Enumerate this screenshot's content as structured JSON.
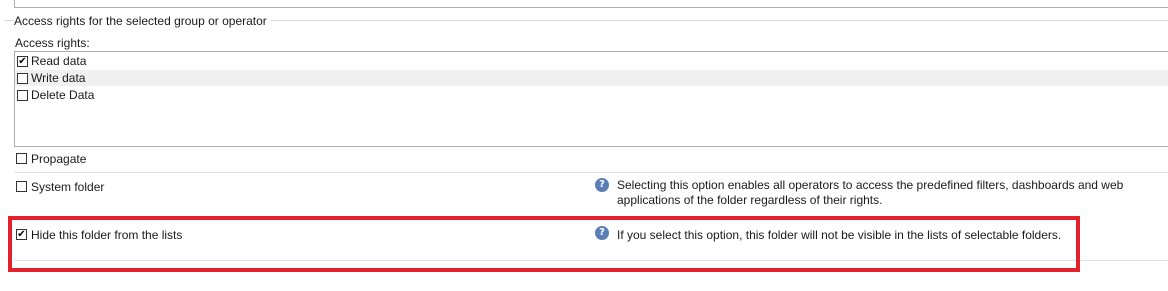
{
  "group": {
    "title": "Access rights for the selected group or operator",
    "access_rights_label": "Access rights:",
    "rights": [
      {
        "label": "Read data",
        "checked": true
      },
      {
        "label": "Write data",
        "checked": false
      },
      {
        "label": "Delete Data",
        "checked": false
      }
    ]
  },
  "options": {
    "propagate": {
      "label": "Propagate",
      "checked": false
    },
    "system_folder": {
      "label": "System folder",
      "checked": false,
      "help_text": "Selecting this option enables all operators to access the predefined filters, dashboards and web applications of the folder regardless of their rights."
    },
    "hide_folder": {
      "label": "Hide this folder from the lists",
      "checked": true,
      "help_text": "If you select this option, this folder will not be visible in the lists of selectable folders."
    }
  },
  "glyphs": {
    "check": "✔",
    "help": "?"
  },
  "colors": {
    "highlight": "#e3212b",
    "help_icon": "#5b7fb4"
  }
}
